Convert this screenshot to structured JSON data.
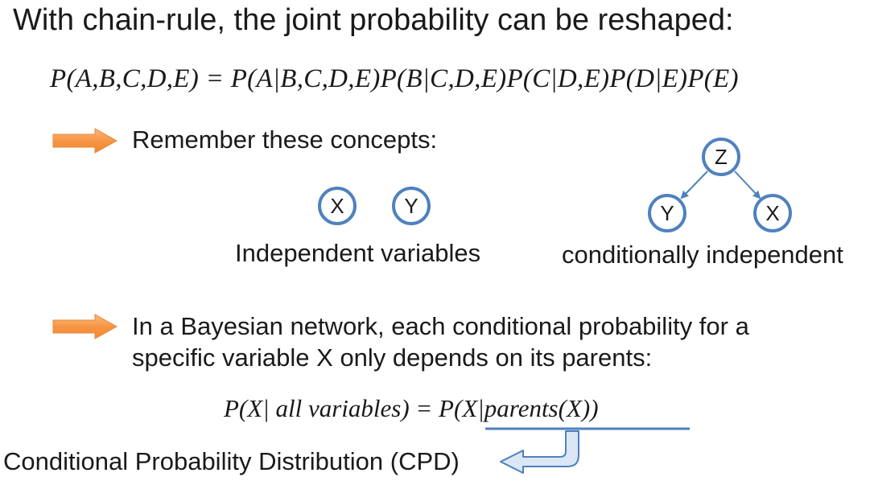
{
  "slide": {
    "title": "With chain-rule, the joint probability can be reshaped:",
    "chain_rule_equation": "P(A,B,C,D,E) = P(A|B,C,D,E)P(B|C,D,E)P(C|D,E)P(D|E)P(E)",
    "bullet_1": "Remember these concepts:",
    "independent": {
      "node_x": "X",
      "node_y": "Y",
      "label": "Independent variables"
    },
    "conditional": {
      "node_z": "Z",
      "node_y": "Y",
      "node_x": "X",
      "label": "conditionally independent"
    },
    "bullet_2_line_1": "In a Bayesian network, each conditional probability for a",
    "bullet_2_line_2": "specific variable X only depends on its parents:",
    "cpd_equation": "P(X| all variables) = P(X|parents(X))",
    "cpd_label": "Conditional Probability Distribution (CPD)"
  },
  "colors": {
    "arrow_fill": "#f79646",
    "node_stroke": "#4f81bd",
    "edge_stroke": "#4f81bd",
    "underline": "#4f81bd",
    "callout_fill": "#dbe7f5",
    "callout_stroke": "#4f81bd"
  },
  "icons": {
    "bullet_arrow": "orange-right-arrow-icon",
    "callout_arrow": "blue-bent-arrow-icon"
  }
}
